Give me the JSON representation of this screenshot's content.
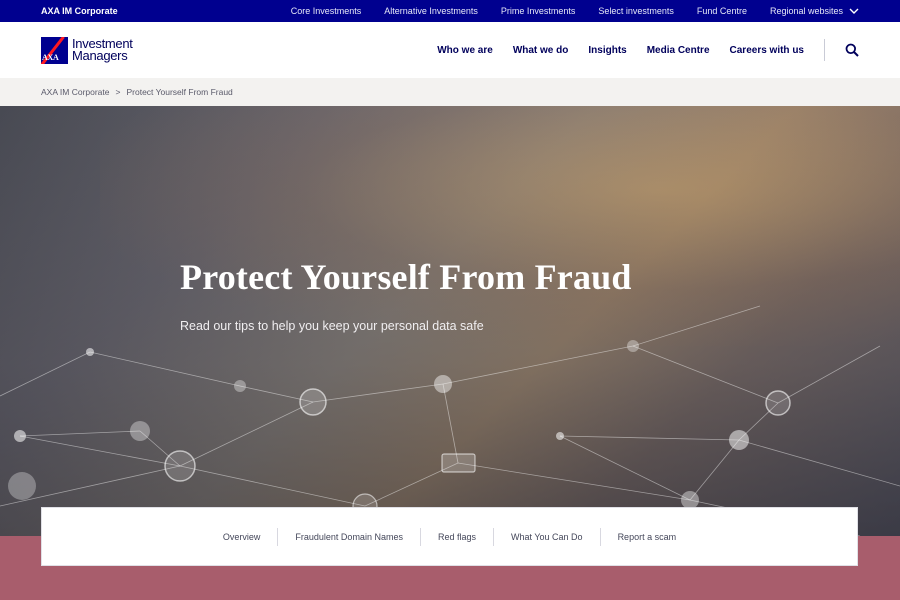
{
  "topbar": {
    "brand": "AXA IM Corporate",
    "links": [
      "Core Investments",
      "Alternative Investments",
      "Prime Investments",
      "Select investments",
      "Fund Centre"
    ],
    "regional": "Regional websites"
  },
  "header": {
    "logo_line1": "Investment",
    "logo_line2": "Managers",
    "logo_mark": "AXA",
    "nav": [
      "Who we are",
      "What we do",
      "Insights",
      "Media Centre",
      "Careers with us"
    ],
    "search_icon": "search-icon"
  },
  "breadcrumb": {
    "items": [
      "AXA IM Corporate",
      "Protect Yourself From Fraud"
    ],
    "separator": ">"
  },
  "hero": {
    "title": "Protect Yourself From Fraud",
    "subtitle": "Read our tips to help you keep your personal data safe"
  },
  "anchors": [
    "Overview",
    "Fraudulent Domain Names",
    "Red flags",
    "What You Can Do",
    "Report a scam"
  ],
  "colors": {
    "brand_blue": "#00008f",
    "navy_text": "#00005b",
    "axa_red": "#ff1721",
    "band": "#a85d6c"
  }
}
